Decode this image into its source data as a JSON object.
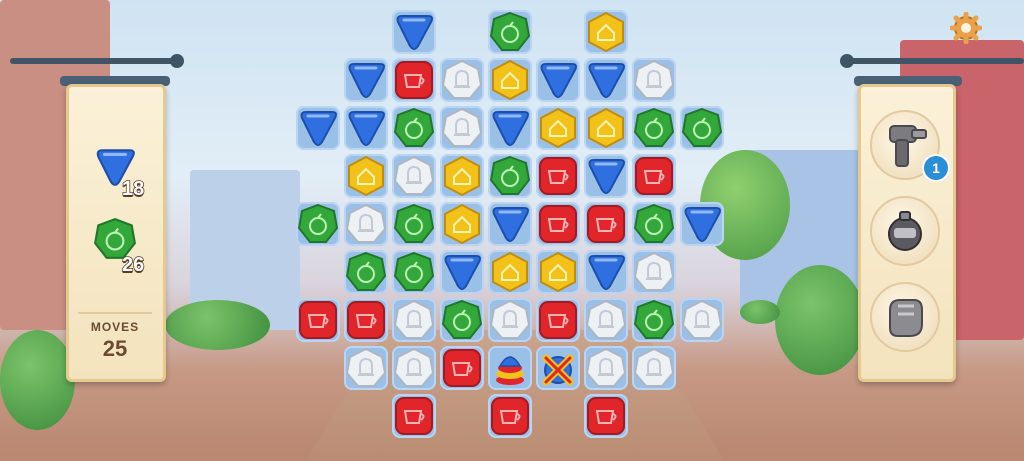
{
  "goals": [
    {
      "piece": "blue-triangle",
      "count": "18"
    },
    {
      "piece": "green-apple",
      "count": "26"
    }
  ],
  "moves": {
    "label": "MOVES",
    "value": "25"
  },
  "boosters": [
    {
      "name": "hammer-icon",
      "badge": "1"
    },
    {
      "name": "bomb-icon",
      "badge": ""
    },
    {
      "name": "glove-icon",
      "badge": ""
    }
  ],
  "colors": {
    "blue": "#2f6fe0",
    "green": "#33a83a",
    "red": "#e0262b",
    "yellow": "#f2c21a",
    "white": "#eef1f4",
    "board": "#9bc0e8"
  },
  "board": {
    "cols": 9,
    "rows": 10,
    "grid": [
      [
        null,
        null,
        "B",
        null,
        "G",
        null,
        "Y",
        null,
        null
      ],
      [
        null,
        "B",
        "R",
        "W",
        "Y",
        "B",
        "B",
        "W",
        null
      ],
      [
        "B",
        "B",
        "G",
        "W",
        "B",
        "Y",
        "Y",
        "G",
        "G"
      ],
      [
        null,
        "Y",
        "W",
        "Y",
        "G",
        "R",
        "B",
        "R",
        null
      ],
      [
        "G",
        "W",
        "G",
        "Y",
        "B",
        "R",
        "R",
        "G",
        "B"
      ],
      [
        null,
        "G",
        "G",
        "B",
        "Y",
        "Y",
        "B",
        "W",
        null
      ],
      [
        "R",
        "R",
        "W",
        "G",
        "W",
        "R",
        "W",
        "G",
        "W"
      ],
      [
        null,
        "W",
        "W",
        "R",
        "S1",
        "S2",
        "W",
        "W",
        null
      ],
      [
        null,
        null,
        "R",
        null,
        "R",
        null,
        "R",
        null,
        null
      ]
    ]
  }
}
